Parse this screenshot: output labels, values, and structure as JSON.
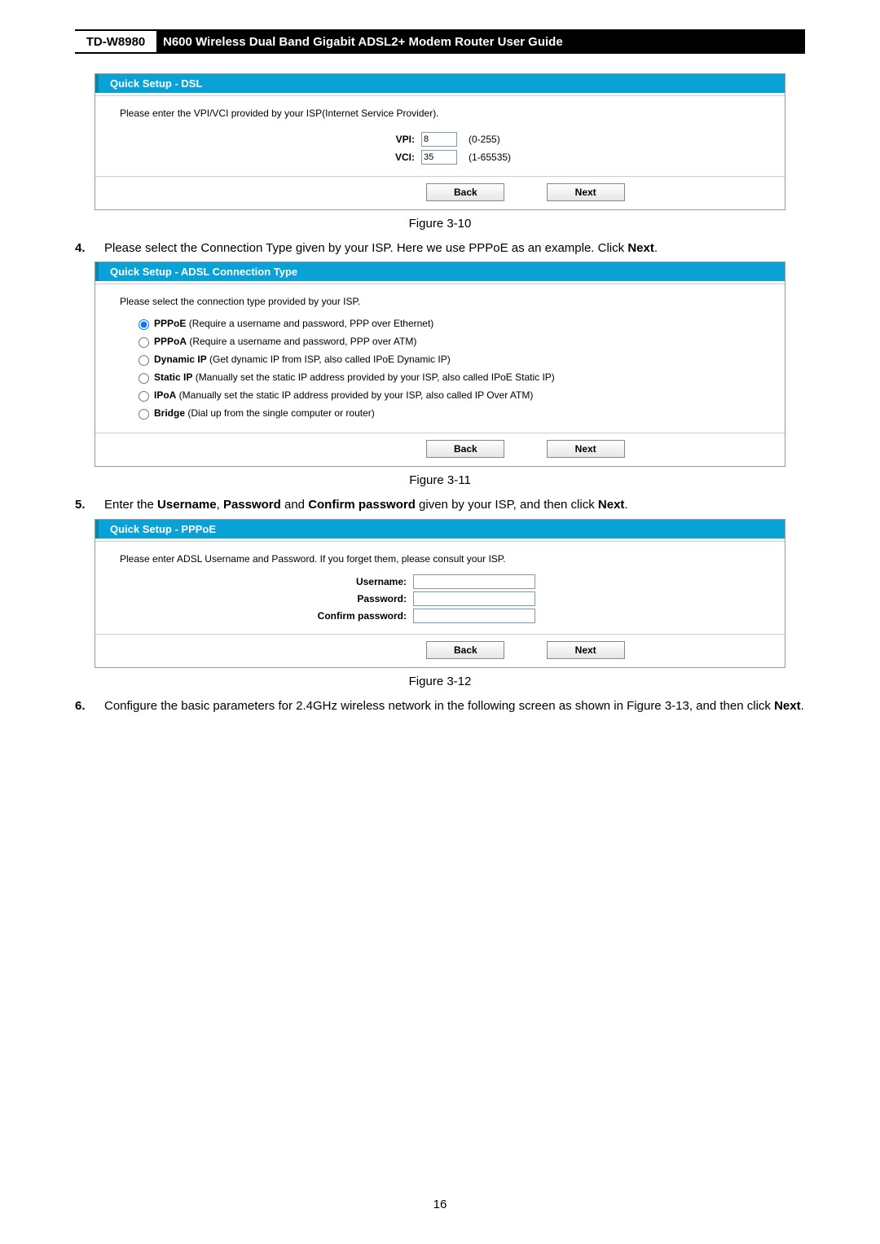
{
  "header": {
    "model": "TD-W8980",
    "title": "N600 Wireless Dual Band Gigabit ADSL2+ Modem Router User Guide"
  },
  "dsl": {
    "panel_title": "Quick Setup - DSL",
    "intro": "Please enter the VPI/VCI provided by your ISP(Internet Service Provider).",
    "vpi_label": "VPI:",
    "vpi_value": "8",
    "vpi_range": "(0-255)",
    "vci_label": "VCI:",
    "vci_value": "35",
    "vci_range": "(1-65535)",
    "back": "Back",
    "next": "Next"
  },
  "fig10": "Figure 3-10",
  "step4": {
    "num": "4.",
    "text_a": "Please select the Connection Type given by your ISP. Here we use PPPoE as an example. Click ",
    "bold": "Next",
    "text_b": "."
  },
  "adsl": {
    "panel_title": "Quick Setup - ADSL Connection Type",
    "intro": "Please select the connection type provided by your ISP.",
    "opts": [
      {
        "name": "PPPoE",
        "desc": " (Require a username and password, PPP over Ethernet)",
        "sel": true
      },
      {
        "name": "PPPoA",
        "desc": " (Require a username and password, PPP over ATM)",
        "sel": false
      },
      {
        "name": "Dynamic IP",
        "desc": " (Get dynamic IP from ISP, also called IPoE Dynamic IP)",
        "sel": false
      },
      {
        "name": "Static IP",
        "desc": " (Manually set the static IP address provided by your ISP, also called IPoE Static IP)",
        "sel": false
      },
      {
        "name": "IPoA",
        "desc": " (Manually set the static IP address provided by your ISP, also called IP Over ATM)",
        "sel": false
      },
      {
        "name": "Bridge",
        "desc": " (Dial up from the single computer or router)",
        "sel": false
      }
    ],
    "back": "Back",
    "next": "Next"
  },
  "fig11": "Figure 3-11",
  "step5": {
    "num": "5.",
    "a": "Enter the ",
    "b1": "Username",
    "c1": ", ",
    "b2": "Password",
    "c2": " and ",
    "b3": "Confirm password",
    "c3": " given by your ISP, and then click ",
    "b4": "Next",
    "c4": "."
  },
  "pppoe": {
    "panel_title": "Quick Setup - PPPoE",
    "intro": "Please enter ADSL Username and Password. If you forget them, please consult your ISP.",
    "user_lbl": "Username:",
    "pass_lbl": "Password:",
    "conf_lbl": "Confirm password:",
    "back": "Back",
    "next": "Next"
  },
  "fig12": "Figure 3-12",
  "step6": {
    "num": "6.",
    "a": "Configure the basic parameters for 2.4GHz wireless network in the following screen as shown in Figure 3-13, and then click ",
    "b": "Next",
    "c": "."
  },
  "page_number": "16"
}
